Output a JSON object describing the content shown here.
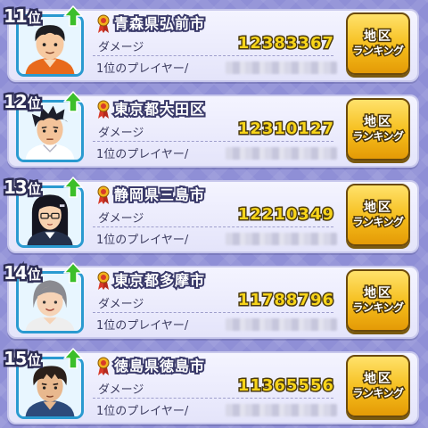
{
  "ranking": [
    {
      "rank": "11",
      "rank_suffix": "位",
      "location": "青森県弘前市",
      "damage_label": "ダメージ",
      "damage": "12383367",
      "player_label": "1位のプレイヤー/",
      "ranking_button_line1": "地区",
      "ranking_button_line2": "ランキング",
      "avatar": "boy-short-hair-avatar",
      "rank_change": "up"
    },
    {
      "rank": "12",
      "rank_suffix": "位",
      "location": "東京都大田区",
      "damage_label": "ダメージ",
      "damage": "12310127",
      "player_label": "1位のプレイヤー/",
      "ranking_button_line1": "地区",
      "ranking_button_line2": "ランキング",
      "avatar": "man-spiky-hair-avatar",
      "rank_change": "up"
    },
    {
      "rank": "13",
      "rank_suffix": "位",
      "location": "静岡県三島市",
      "damage_label": "ダメージ",
      "damage": "12210349",
      "player_label": "1位のプレイヤー/",
      "ranking_button_line1": "地区",
      "ranking_button_line2": "ランキング",
      "avatar": "girl-glasses-avatar",
      "rank_change": "up"
    },
    {
      "rank": "14",
      "rank_suffix": "位",
      "location": "東京都多摩市",
      "damage_label": "ダメージ",
      "damage": "11788796",
      "player_label": "1位のプレイヤー/",
      "ranking_button_line1": "地区",
      "ranking_button_line2": "ランキング",
      "avatar": "woman-short-hair-avatar",
      "rank_change": "up"
    },
    {
      "rank": "15",
      "rank_suffix": "位",
      "location": "徳島県徳島市",
      "damage_label": "ダメージ",
      "damage": "11365556",
      "player_label": "1位のプレイヤー/",
      "ranking_button_line1": "地区",
      "ranking_button_line2": "ランキング",
      "avatar": "man-messy-hair-avatar",
      "rank_change": "up"
    }
  ],
  "colors": {
    "background": "#8f8fd6",
    "damage_text": "#f7d41a",
    "button_gold": "#f5bd1b",
    "arrow_green": "#3cbf2a",
    "frame_blue": "#2a9ad0"
  }
}
